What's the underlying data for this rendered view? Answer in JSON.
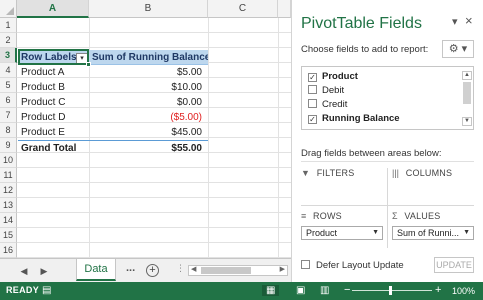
{
  "sheet": {
    "columns": [
      "A",
      "B",
      "C"
    ],
    "rows": [
      "1",
      "2",
      "3",
      "4",
      "5",
      "6",
      "7",
      "8",
      "9",
      "10",
      "11",
      "12",
      "13",
      "14",
      "15",
      "16"
    ],
    "pivot_header": {
      "label": "Row Labels",
      "value": "Sum of Running Balance"
    },
    "pivot_rows": [
      {
        "label": "Product A",
        "value": "$5.00"
      },
      {
        "label": "Product B",
        "value": "$10.00"
      },
      {
        "label": "Product C",
        "value": "$0.00"
      },
      {
        "label": "Product D",
        "value": "($5.00)"
      },
      {
        "label": "Product E",
        "value": "$45.00"
      }
    ],
    "grand_total": {
      "label": "Grand Total",
      "value": "$55.00"
    },
    "filter_glyph": "▾",
    "tabs": {
      "active": "Data",
      "more": "...",
      "add": "+"
    }
  },
  "pivot_pane": {
    "title": "PivotTable Fields",
    "close_glyph": "×",
    "dropdown_glyph": "▾",
    "choose_label": "Choose fields to add to report:",
    "gear_glyph": "⚙ ▾",
    "fields": [
      {
        "label": "Product",
        "checked": "✓"
      },
      {
        "label": "Debit",
        "checked": ""
      },
      {
        "label": "Credit",
        "checked": ""
      },
      {
        "label": "Running Balance",
        "checked": "✓"
      }
    ],
    "drag_label": "Drag fields between areas below:",
    "areas": {
      "filters": "FILTERS",
      "columns": "COLUMNS",
      "rows": "ROWS",
      "values": "VALUES",
      "rows_field": "Product",
      "values_field": "Sum of Runni..."
    },
    "defer_label": "Defer Layout Update",
    "update_label": "UPDATE"
  },
  "status_bar": {
    "ready": "READY",
    "zoom_minus": "−",
    "zoom_plus": "+",
    "zoom_percent": "100%",
    "zoom_level": 100
  },
  "colors": {
    "excel_green": "#217346",
    "pivot_header_fill": "#bdd7ee",
    "negative": "#e02020"
  }
}
